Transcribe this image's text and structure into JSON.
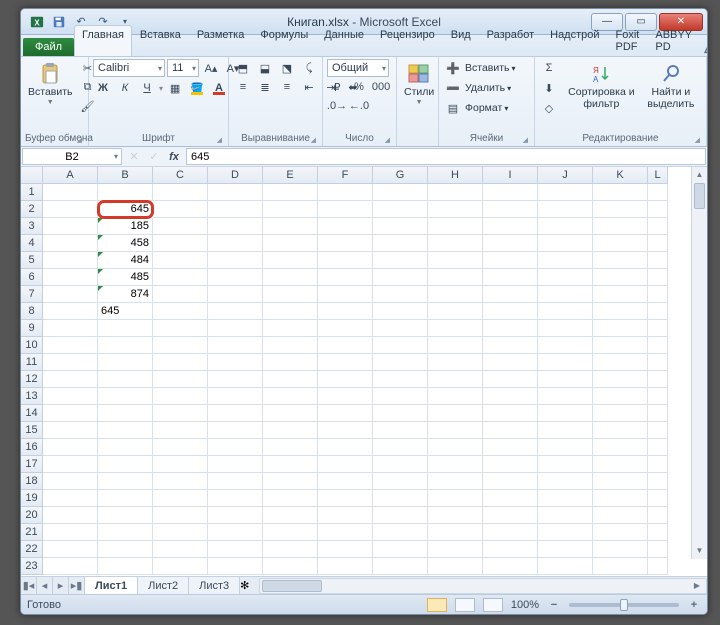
{
  "window": {
    "filename": "Книгаn.xlsx",
    "appname": "Microsoft Excel"
  },
  "qat": {
    "save": "save",
    "undo": "undo",
    "redo": "redo"
  },
  "ribbon": {
    "file": "Файл",
    "tabs": [
      "Главная",
      "Вставка",
      "Разметка",
      "Формулы",
      "Данные",
      "Рецензиро",
      "Вид",
      "Разработ",
      "Надстрой",
      "Foxit PDF",
      "ABBYY PD"
    ],
    "active_tab": 0,
    "groups": {
      "clipboard": {
        "label": "Буфер обмена",
        "paste": "Вставить"
      },
      "font": {
        "label": "Шрифт",
        "name": "Calibri",
        "size": "11"
      },
      "align": {
        "label": "Выравнивание"
      },
      "number": {
        "label": "Число",
        "fmt": "Общий"
      },
      "styles": {
        "label": "Стили",
        "btn": "Стили"
      },
      "cells": {
        "label": "Ячейки",
        "insert": "Вставить",
        "delete": "Удалить",
        "format": "Формат"
      },
      "editing": {
        "label": "Редактирование",
        "sort": "Сортировка и фильтр",
        "find": "Найти и выделить"
      }
    }
  },
  "formula_bar": {
    "name": "B2",
    "fx": "fx",
    "value": "645"
  },
  "columns": [
    "A",
    "B",
    "C",
    "D",
    "E",
    "F",
    "G",
    "H",
    "I",
    "J",
    "K",
    "L"
  ],
  "row_count": 23,
  "cells": {
    "B2": "645",
    "B3": "185",
    "B4": "458",
    "B5": "484",
    "B6": "485",
    "B7": "874",
    "B8": "645"
  },
  "text_marked": [
    "B3",
    "B4",
    "B5",
    "B6",
    "B7"
  ],
  "selected": "B2",
  "left_aligned": [
    "B8"
  ],
  "sheets": {
    "list": [
      "Лист1",
      "Лист2",
      "Лист3"
    ],
    "active": 0
  },
  "status": {
    "ready": "Готово",
    "zoom": "100%"
  }
}
